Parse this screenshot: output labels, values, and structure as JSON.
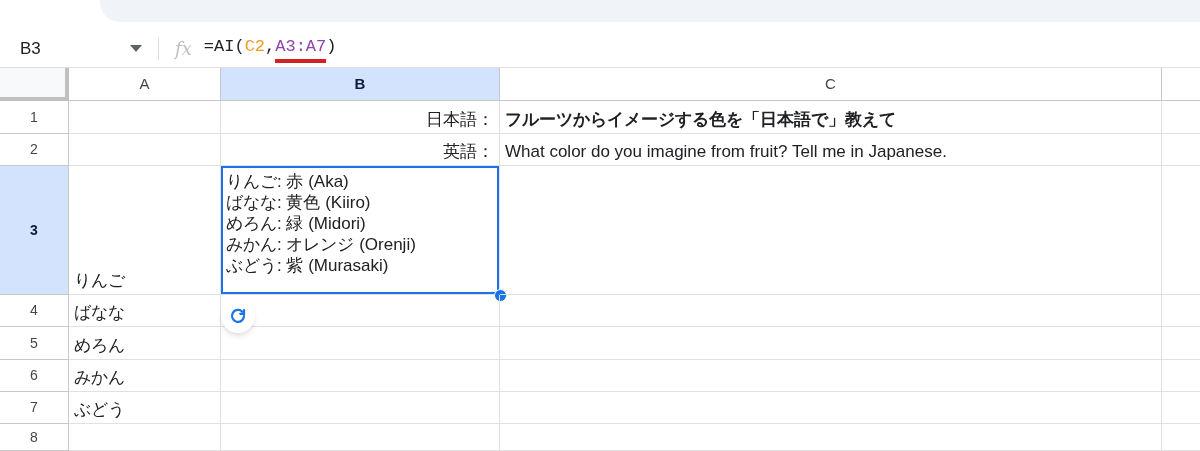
{
  "name_box": {
    "value": "B3"
  },
  "formula": {
    "icon_label": "fx",
    "segments": [
      {
        "text": "=AI(",
        "color": "#202124",
        "underlined": false
      },
      {
        "text": "C2",
        "color": "#f29b1d",
        "underlined": false
      },
      {
        "text": ",",
        "color": "#202124",
        "underlined": false
      },
      {
        "text": "A3:A7",
        "color": "#8e44ad",
        "underlined": true
      },
      {
        "text": ")",
        "color": "#202124",
        "underlined": false
      }
    ]
  },
  "columns": [
    {
      "label": "A",
      "selected": false
    },
    {
      "label": "B",
      "selected": true
    },
    {
      "label": "C",
      "selected": false
    }
  ],
  "rows": [
    {
      "number": "1",
      "selected": false,
      "cells": [
        {
          "kind": "plain"
        },
        {
          "kind": "label",
          "lines": [
            "日本語："
          ]
        },
        {
          "kind": "heading",
          "lines": [
            "フルーツからイメージする色を「日本語で」教えて"
          ]
        }
      ]
    },
    {
      "number": "2",
      "selected": false,
      "cells": [
        {
          "kind": "plain"
        },
        {
          "kind": "label",
          "lines": [
            "英語："
          ]
        },
        {
          "kind": "plain",
          "lines": [
            "What color do you imagine from fruit? Tell me in Japanese."
          ]
        }
      ]
    },
    {
      "number": "3",
      "selected": true,
      "cells": [
        {
          "kind": "plain",
          "lines": [
            "りんご"
          ]
        },
        {
          "kind": "wrapped",
          "lines": [
            "りんご: 赤 (Aka)",
            "ばなな: 黄色 (Kiiro)",
            "めろん: 緑 (Midori)",
            "みかん: オレンジ (Orenji)",
            "ぶどう: 紫 (Murasaki)"
          ]
        },
        {
          "kind": "plain"
        }
      ]
    },
    {
      "number": "4",
      "selected": false,
      "cells": [
        {
          "kind": "plain",
          "lines": [
            "ばなな"
          ]
        },
        {
          "kind": "plain"
        },
        {
          "kind": "plain"
        }
      ]
    },
    {
      "number": "5",
      "selected": false,
      "cells": [
        {
          "kind": "plain",
          "lines": [
            "めろん"
          ]
        },
        {
          "kind": "plain"
        },
        {
          "kind": "plain"
        }
      ]
    },
    {
      "number": "6",
      "selected": false,
      "cells": [
        {
          "kind": "plain",
          "lines": [
            "みかん"
          ]
        },
        {
          "kind": "plain"
        },
        {
          "kind": "plain"
        }
      ]
    },
    {
      "number": "7",
      "selected": false,
      "cells": [
        {
          "kind": "plain",
          "lines": [
            "ぶどう"
          ]
        },
        {
          "kind": "plain"
        },
        {
          "kind": "plain"
        }
      ]
    },
    {
      "number": "8",
      "selected": false,
      "cells": [
        {
          "kind": "plain"
        },
        {
          "kind": "plain"
        },
        {
          "kind": "plain"
        }
      ]
    }
  ]
}
